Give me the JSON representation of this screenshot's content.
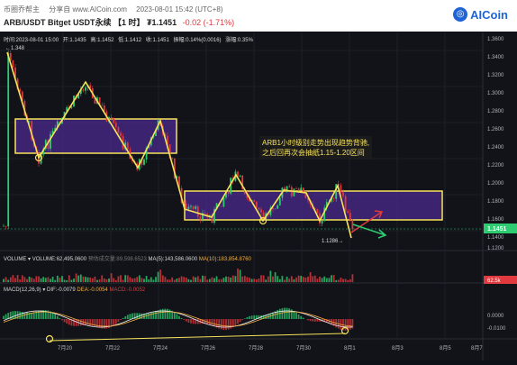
{
  "header": {
    "tabs": [
      "币圈乔帮主",
      "分享自 www.AICoin.com",
      "2023-08-01 15:42 (UTC+8)"
    ],
    "pair": "ARB/USDT Bitget USDT永续",
    "interval": "【1 时】",
    "price": "₮1.1451",
    "change": "-0.02 (-1.71%)",
    "logo_text": "AICoin"
  },
  "infobar": {
    "time": "时间:2023-08-01 15:00",
    "open": "开:1.1435",
    "high": "高:1.1452",
    "low": "低:1.1412",
    "close": "收:1.1451",
    "amp": "振幅:0.14%(0.0016)",
    "zf": "涨幅:0.35%"
  },
  "annotation": {
    "line1": "ARB1小时级别走势出现趋势背驰,",
    "line2": "之后回再次会抽纸1.15-1.20区间"
  },
  "price_labels": {
    "high_mark": "←1.348",
    "low_mark": "1.1286→",
    "current": "1.1451"
  },
  "y_axis": [
    "1.3600",
    "1.3400",
    "1.3200",
    "1.3000",
    "1.2800",
    "1.2600",
    "1.2400",
    "1.2200",
    "1.2000",
    "1.1800",
    "1.1600",
    "1.1400",
    "1.1200"
  ],
  "volume": {
    "label": "VOLUME",
    "vol": "VOLUME:62,495.0600",
    "est": "预估成交量:89,598.6523",
    "ma5": "MA(5):143,586.0600",
    "ma10": "MA(10):183,854.8760",
    "axis_label": "62.5k"
  },
  "macd": {
    "label": "MACD(12,26,9)",
    "dif": "DIF:-0.0079",
    "dea": "DEA:-0.0054",
    "macd": "MACD:-0.0052",
    "axis": [
      "0.0000",
      "-0.0100"
    ]
  },
  "x_axis": [
    "7月20",
    "7月22",
    "7月24",
    "7月26",
    "7月28",
    "7月30",
    "8月1",
    "8月3",
    "8月5",
    "8月7"
  ],
  "colors": {
    "up": "#2ecc71",
    "down": "#e0393e",
    "annotation": "#f7e35a",
    "zone_fill": "#4b2a8c"
  }
}
